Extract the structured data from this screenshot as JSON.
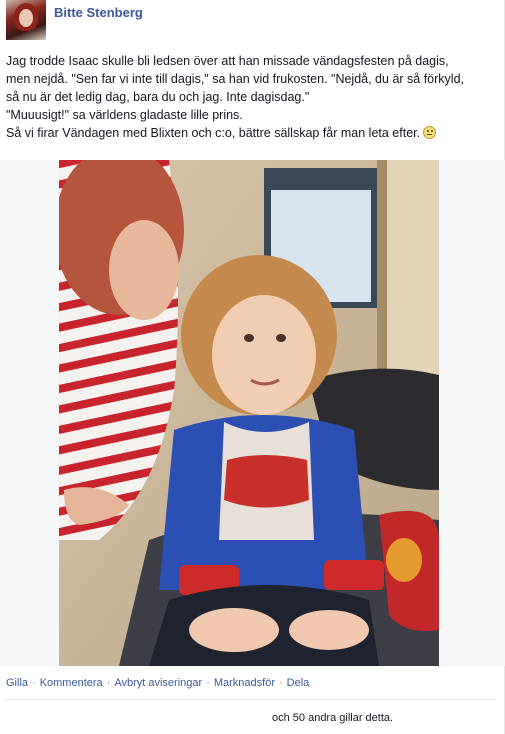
{
  "post": {
    "author": "Bitte Stenberg",
    "text_lines": [
      "Jag trodde Isaac skulle bli ledsen över att han missade vändagsfesten på dagis,",
      "men nejdå. \"Sen far vi inte till dagis,\" sa han vid frukosten. \"Nejdå, du är så förkyld,",
      "så nu är det ledig dag, bara du och jag. Inte dagisdag.\"",
      "\"Muuusigt!\" sa världens gladaste lille prins.",
      "Så vi firar Vändagen med Blixten och c:o, bättre sällskap får man leta efter."
    ],
    "emoticon": "smiley-icon"
  },
  "actions": {
    "like": "Gilla",
    "comment": "Kommentera",
    "unfollow": "Avbryt aviseringar",
    "promote": "Marknadsför",
    "share": "Dela",
    "separator": "·"
  },
  "likes_text": "och 50 andra gillar detta.",
  "colors": {
    "link": "#3b5998",
    "text": "#141823",
    "muted": "#9197a3",
    "divider": "#e5e6e9"
  }
}
